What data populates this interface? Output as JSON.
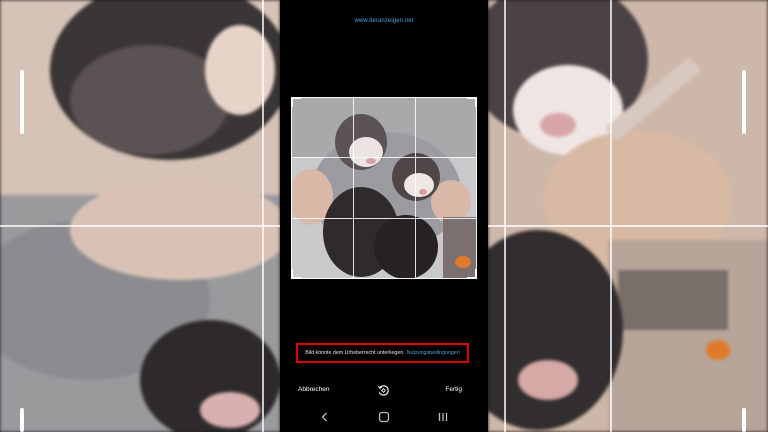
{
  "source": {
    "domain": "www.tieranzeigen.net"
  },
  "copyright_notice": {
    "text": "Bild könnte dem Urheberrecht unterliegen.",
    "link": "Nutzungsbedingungen",
    "highlight_color": "#e00000"
  },
  "actions": {
    "cancel_label": "Abbrechen",
    "done_label": "Fertig",
    "rotate_icon": "rotate-icon"
  },
  "nav": {
    "back_icon": "back-icon",
    "home_icon": "home-icon",
    "recents_icon": "recents-icon"
  },
  "colors": {
    "link": "#4aa3df",
    "background": "#000000"
  }
}
